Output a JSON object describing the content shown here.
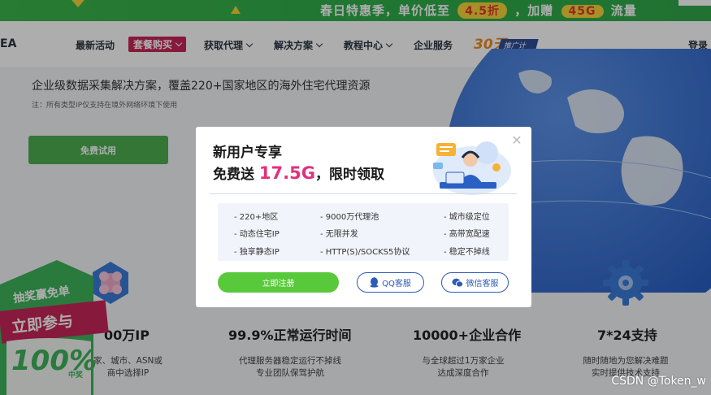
{
  "promo": {
    "text_prefix": "春日特惠季，单价低至",
    "discount": "4.5折",
    "text_mid": "，加赠",
    "bonus": "45G",
    "text_suffix": "流量"
  },
  "nav": {
    "logo_fragment": "EA",
    "items": [
      {
        "label": "最新活动"
      },
      {
        "label": "套餐购买"
      },
      {
        "label": "获取代理"
      },
      {
        "label": "解决方案"
      },
      {
        "label": "教程中心"
      },
      {
        "label": "企业服务"
      }
    ],
    "badge_num": "30天",
    "badge_tag": "推广计划",
    "login": "登录"
  },
  "hero": {
    "subtitle": "企业级数据采集解决方案，覆盖220+国家地区的海外住宅代理资源",
    "note": "注：所有类型IP仅支持在境外网络环境下使用",
    "trial_button": "免费试用"
  },
  "features": [
    {
      "title": "00万IP",
      "desc1": "家、城市、ASN或",
      "desc2": "商中选择IP",
      "icon": "flower-icon"
    },
    {
      "title": "99.9%正常运行时间",
      "desc1": "代理服务器稳定运行不掉线",
      "desc2": "专业团队保驾护航"
    },
    {
      "title": "10000+企业合作",
      "desc1": "与全球超过1万家企业",
      "desc2": "达成深度合作"
    },
    {
      "title": "7*24支持",
      "desc1": "随时随地为您解决难题",
      "desc2": "实时提供技术支持",
      "icon": "gear-icon"
    }
  ],
  "lottery": {
    "top": "抽奖赢免单",
    "mid": "立即参与",
    "big": "100%",
    "small": "中奖"
  },
  "modal": {
    "title_line1": "新用户专享",
    "title_prefix": "免费送 ",
    "title_highlight": "17.5G",
    "title_suffix": "，限时领取",
    "features": [
      [
        "- 220+地区",
        "- 9000万代理池",
        "- 城市级定位"
      ],
      [
        "- 动态住宅IP",
        "- 无限并发",
        "- 高带宽配速"
      ],
      [
        "- 独享静态IP",
        "- HTTP(S)/SOCKS5协议",
        "- 稳定不掉线"
      ]
    ],
    "register_button": "立即注册",
    "qq_button": "QQ客服",
    "wechat_button": "微信客服"
  },
  "watermark": "CSDN @Token_w"
}
